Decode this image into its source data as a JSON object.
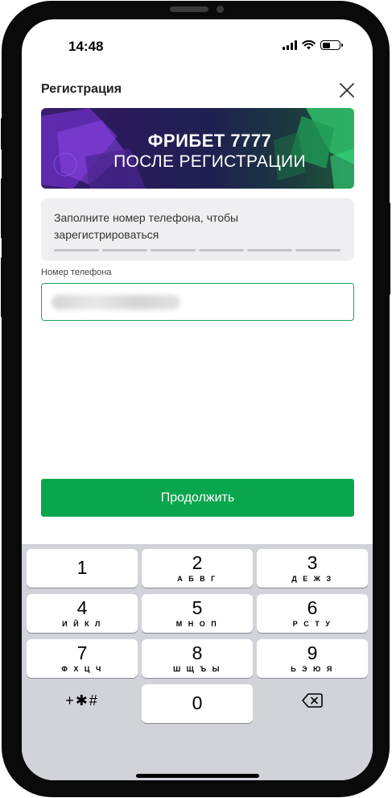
{
  "status_bar": {
    "time": "14:48"
  },
  "header": {
    "title": "Регистрация"
  },
  "banner": {
    "line1": "ФРИБЕТ 7777",
    "line2": "ПОСЛЕ РЕГИСТРАЦИИ"
  },
  "info": {
    "text": "Заполните номер телефона, чтобы зарегистрироваться",
    "progress_steps": 6
  },
  "phone_field": {
    "label": "Номер телефона",
    "value": "+7 999 123 45 67 (blurred)"
  },
  "continue_button": {
    "label": "Продолжить"
  },
  "keypad": {
    "keys": [
      {
        "digit": "1",
        "letters": ""
      },
      {
        "digit": "2",
        "letters": "А Б В Г"
      },
      {
        "digit": "3",
        "letters": "Д Е Ж З"
      },
      {
        "digit": "4",
        "letters": "И Й К Л"
      },
      {
        "digit": "5",
        "letters": "М Н О П"
      },
      {
        "digit": "6",
        "letters": "Р С Т У"
      },
      {
        "digit": "7",
        "letters": "Ф Х Ц Ч"
      },
      {
        "digit": "8",
        "letters": "Ш Щ Ъ Ы"
      },
      {
        "digit": "9",
        "letters": "Ь Э Ю Я"
      },
      {
        "digit": "0",
        "letters": ""
      }
    ],
    "symbols_label": "+✱#"
  },
  "colors": {
    "accent_green": "#0aa64e",
    "field_border": "#1aa359",
    "banner_purple": "#3b1d6e"
  }
}
